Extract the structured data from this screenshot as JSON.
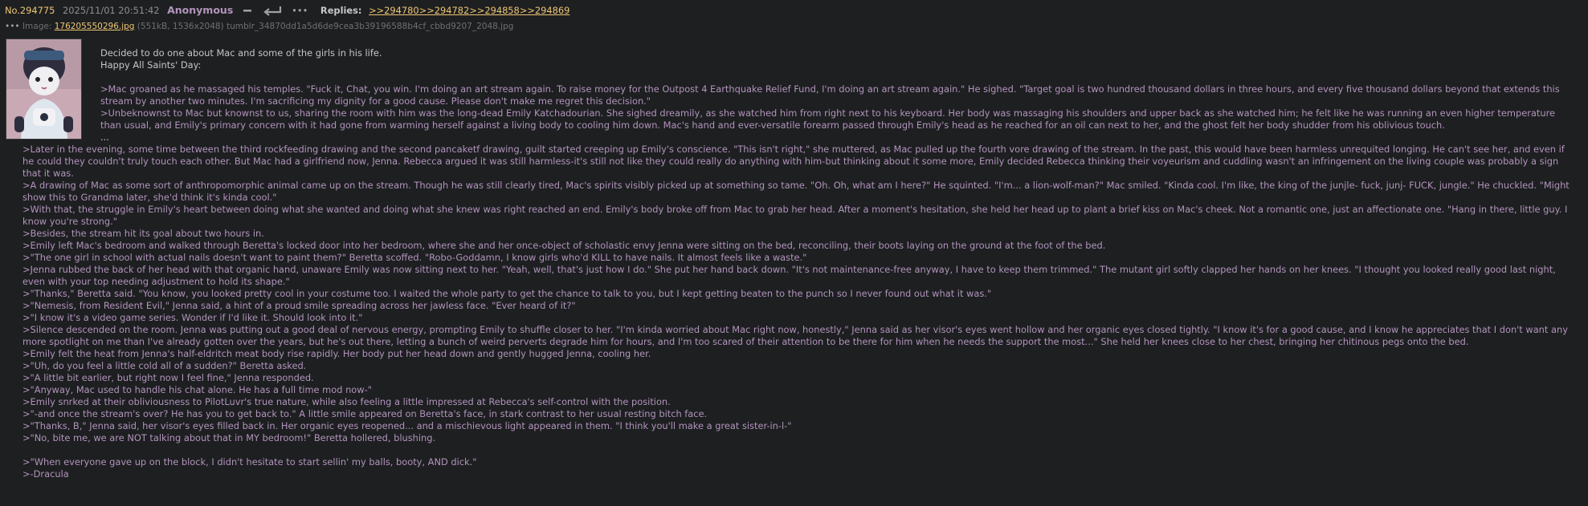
{
  "post": {
    "number": "No.294775",
    "date": "2025/11/01 20:51:42",
    "name": "Anonymous",
    "icons": [
      "minus-icon",
      "return-arrow-icon",
      "more-icon"
    ],
    "more_label": "•••",
    "replies_label": "Replies:",
    "replies": [
      ">>294780",
      ">>294782",
      ">>294858",
      ">>294869"
    ]
  },
  "file": {
    "more_label": "•••",
    "label": "Image:",
    "filename": "176205550296.jpg",
    "meta": "(551kB, 1536x2048)",
    "original_name": "tumblr_34870dd1a5d6de9cea3b39196588b4cf_cbbd9207_2048.jpg"
  },
  "body_top": [
    {
      "text": "Decided to do one about Mac and some of the girls in his life.",
      "quote": false
    },
    {
      "text": "Happy All Saints' Day:",
      "quote": false
    },
    {
      "text": "",
      "quote": false
    },
    {
      "text": ">Mac groaned as he massaged his temples. \"Fuck it, Chat, you win. I'm doing an art stream again. To raise money for the Outpost 4 Earthquake Relief Fund, I'm doing an art stream again.\" He sighed. \"Target goal is two hundred thousand dollars in three hours, and every five thousand dollars beyond that extends this stream by another two minutes. I'm sacrificing my dignity for a good cause. Please don't make me regret this decision.\"",
      "quote": true
    },
    {
      "text": ">Unbeknownst to Mac but knownst to us, sharing the room with him was the long-dead Emily Katchadourian. She sighed dreamily, as she watched him from right next to his keyboard. Her body was massaging his shoulders and upper back as she watched him; he felt like he was running an even higher temperature than usual, and Emily's primary concern with it had gone from warming herself against a living body to cooling him down. Mac's hand and ever-versatile forearm passed through Emily's head as he reached for an oil can next to her, and the ghost felt her body shudder from his oblivious touch.",
      "quote": true
    },
    {
      "text": "...",
      "quote": false
    }
  ],
  "body_bottom": [
    {
      "text": ">Later in the evening, some time between the third rockfeeding drawing and the second pancaketf drawing, guilt started creeping up Emily's conscience. \"This isn't right,\" she muttered, as Mac pulled up the fourth vore drawing of the stream. In the past, this would have been harmless unrequited longing. He can't see her, and even if he could they couldn't truly touch each other. But Mac had a girlfriend now, Jenna. Rebecca argued it was still harmless-it's still not like they could really do anything with him-but thinking about it some more, Emily decided Rebecca thinking their voyeurism and cuddling wasn't an infringement on the living couple was probably a sign that it was.",
      "quote": true
    },
    {
      "text": ">A drawing of Mac as some sort of anthropomorphic animal came up on the stream. Though he was still clearly tired, Mac's spirits visibly picked up at something so tame. \"Oh. Oh, what am I here?\" He squinted. \"I'm... a lion-wolf-man?\" Mac smiled. \"Kinda cool. I'm like, the king of the junjle- fuck, junj- FUCK, jungle.\" He chuckled. \"Might show this to Grandma later, she'd think it's kinda cool.\"",
      "quote": true
    },
    {
      "text": ">With that, the struggle in Emily's heart between doing what she wanted and doing what she knew was right reached an end. Emily's body broke off from Mac to grab her head. After a moment's hesitation, she held her head up to plant a brief kiss on Mac's cheek. Not a romantic one, just an affectionate one. \"Hang in there, little guy. I know you're strong.\"",
      "quote": true
    },
    {
      "text": ">Besides, the stream hit its goal about two hours in.",
      "quote": true
    },
    {
      "text": ">Emily left Mac's bedroom and walked through Beretta's locked door into her bedroom, where she and her once-object of scholastic envy Jenna were sitting on the bed, reconciling, their boots laying on the ground at the foot of the bed.",
      "quote": true
    },
    {
      "text": ">\"The one girl in school with actual nails doesn't want to paint them?\" Beretta scoffed. \"Robo-Goddamn, I know girls who'd KILL to have nails. It almost feels like a waste.\"",
      "quote": true
    },
    {
      "text": ">Jenna rubbed the back of her head with that organic hand, unaware Emily was now sitting next to her. \"Yeah, well, that's just how I do.\" She put her hand back down. \"It's not maintenance-free anyway, I have to keep them trimmed.\" The mutant girl softly clapped her hands on her knees. \"I thought you looked really good last night, even with your top needing adjustment to hold its shape.\"",
      "quote": true
    },
    {
      "text": ">\"Thanks,\" Beretta said. \"You know, you looked pretty cool in your costume too. I waited the whole party to get the chance to talk to you, but I kept getting beaten to the punch so I never found out what it was.\"",
      "quote": true
    },
    {
      "text": ">\"Nemesis, from Resident Evil,\" Jenna said, a hint of a proud smile spreading across her jawless face. \"Ever heard of it?\"",
      "quote": true
    },
    {
      "text": ">\"I know it's a video game series. Wonder if I'd like it. Should look into it.\"",
      "quote": true
    },
    {
      "text": ">Silence descended on the room. Jenna was putting out a good deal of nervous energy, prompting Emily to shuffle closer to her. \"I'm kinda worried about Mac right now, honestly,\" Jenna said as her visor's eyes went hollow and her organic eyes closed tightly. \"I know it's for a good cause, and I know he appreciates that I don't want any more spotlight on me than I've already gotten over the years, but he's out there, letting a bunch of weird perverts degrade him for hours, and I'm too scared of their attention to be there for him when he needs the support the most...\" She held her knees close to her chest, bringing her chitinous pegs onto the bed.",
      "quote": true
    },
    {
      "text": ">Emily felt the heat from Jenna's half-eldritch meat body rise rapidly. Her body put her head down and gently hugged Jenna, cooling her.",
      "quote": true
    },
    {
      "text": ">\"Uh, do you feel a little cold all of a sudden?\" Beretta asked.",
      "quote": true
    },
    {
      "text": ">\"A little bit earlier, but right now I feel fine,\" Jenna responded.",
      "quote": true
    },
    {
      "text": ">\"Anyway, Mac used to handle his chat alone. He has a full time mod now-\"",
      "quote": true
    },
    {
      "text": ">Emily snrked at their obliviousness to PilotLuvr's true nature, while also feeling a little impressed at Rebecca's self-control with the position.",
      "quote": true
    },
    {
      "text": ">\"-and once the stream's over? He has you to get back to.\" A little smile appeared on Beretta's face, in stark contrast to her usual resting bitch face.",
      "quote": true
    },
    {
      "text": ">\"Thanks, B,\" Jenna said, her visor's eyes filled back in. Her organic eyes reopened... and a mischievous light appeared in them. \"I think you'll make a great sister-in-l-\"",
      "quote": true
    },
    {
      "text": ">\"No, bite me, we are NOT talking about that in MY bedroom!\" Beretta hollered, blushing.",
      "quote": true
    },
    {
      "text": "",
      "quote": false
    },
    {
      "text": ">\"When everyone gave up on the block, I didn't hesitate to start sellin' my balls, booty, AND dick.\"",
      "quote": true
    },
    {
      "text": ">-Dracula",
      "quote": true
    }
  ]
}
